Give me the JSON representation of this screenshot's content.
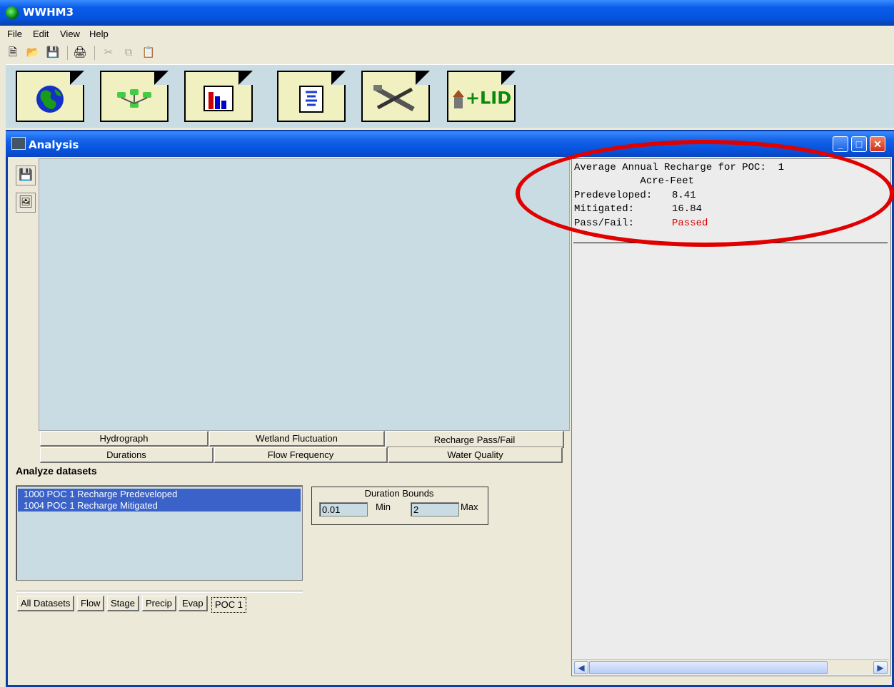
{
  "app": {
    "title": "WWHM3"
  },
  "menu": [
    "File",
    "Edit",
    "View",
    "Help"
  ],
  "toolbar": [
    "new-icon",
    "open-icon",
    "save-icon",
    "print-icon",
    "cut-icon",
    "copy-icon",
    "paste-icon"
  ],
  "big_toolbar": {
    "lid_label": "+LID"
  },
  "window": {
    "title": "Analysis"
  },
  "graph_tabs": {
    "hydrograph": "Hydrograph",
    "wetland": "Wetland Fluctuation",
    "recharge": "Recharge Pass/Fail",
    "durations": "Durations",
    "flow_frequency": "Flow Frequency",
    "water_quality": "Water Quality"
  },
  "analyze": {
    "label": "Analyze datasets",
    "datasets": [
      "1000 POC 1 Recharge Predeveloped",
      "1004 POC 1 Recharge Mitigated"
    ],
    "tabs": [
      "All Datasets",
      "Flow",
      "Stage",
      "Precip",
      "Evap",
      "POC 1"
    ],
    "selected_tab": "POC 1"
  },
  "duration_bounds": {
    "title": "Duration Bounds",
    "min_value": "0.01",
    "min_label": "Min",
    "max_value": "2",
    "max_label": "Max"
  },
  "results": {
    "line1": "Average Annual Recharge for POC:  1",
    "line2": "           Acre-Feet",
    "predev_label": "Predeveloped:",
    "predev_value": "8.41",
    "mitigated_label": "Mitigated:",
    "mitigated_value": "16.84",
    "passfail_label": "Pass/Fail:",
    "passfail_value": "Passed",
    "passfail_color": "#e00000"
  },
  "highlight_color": "#e00000"
}
